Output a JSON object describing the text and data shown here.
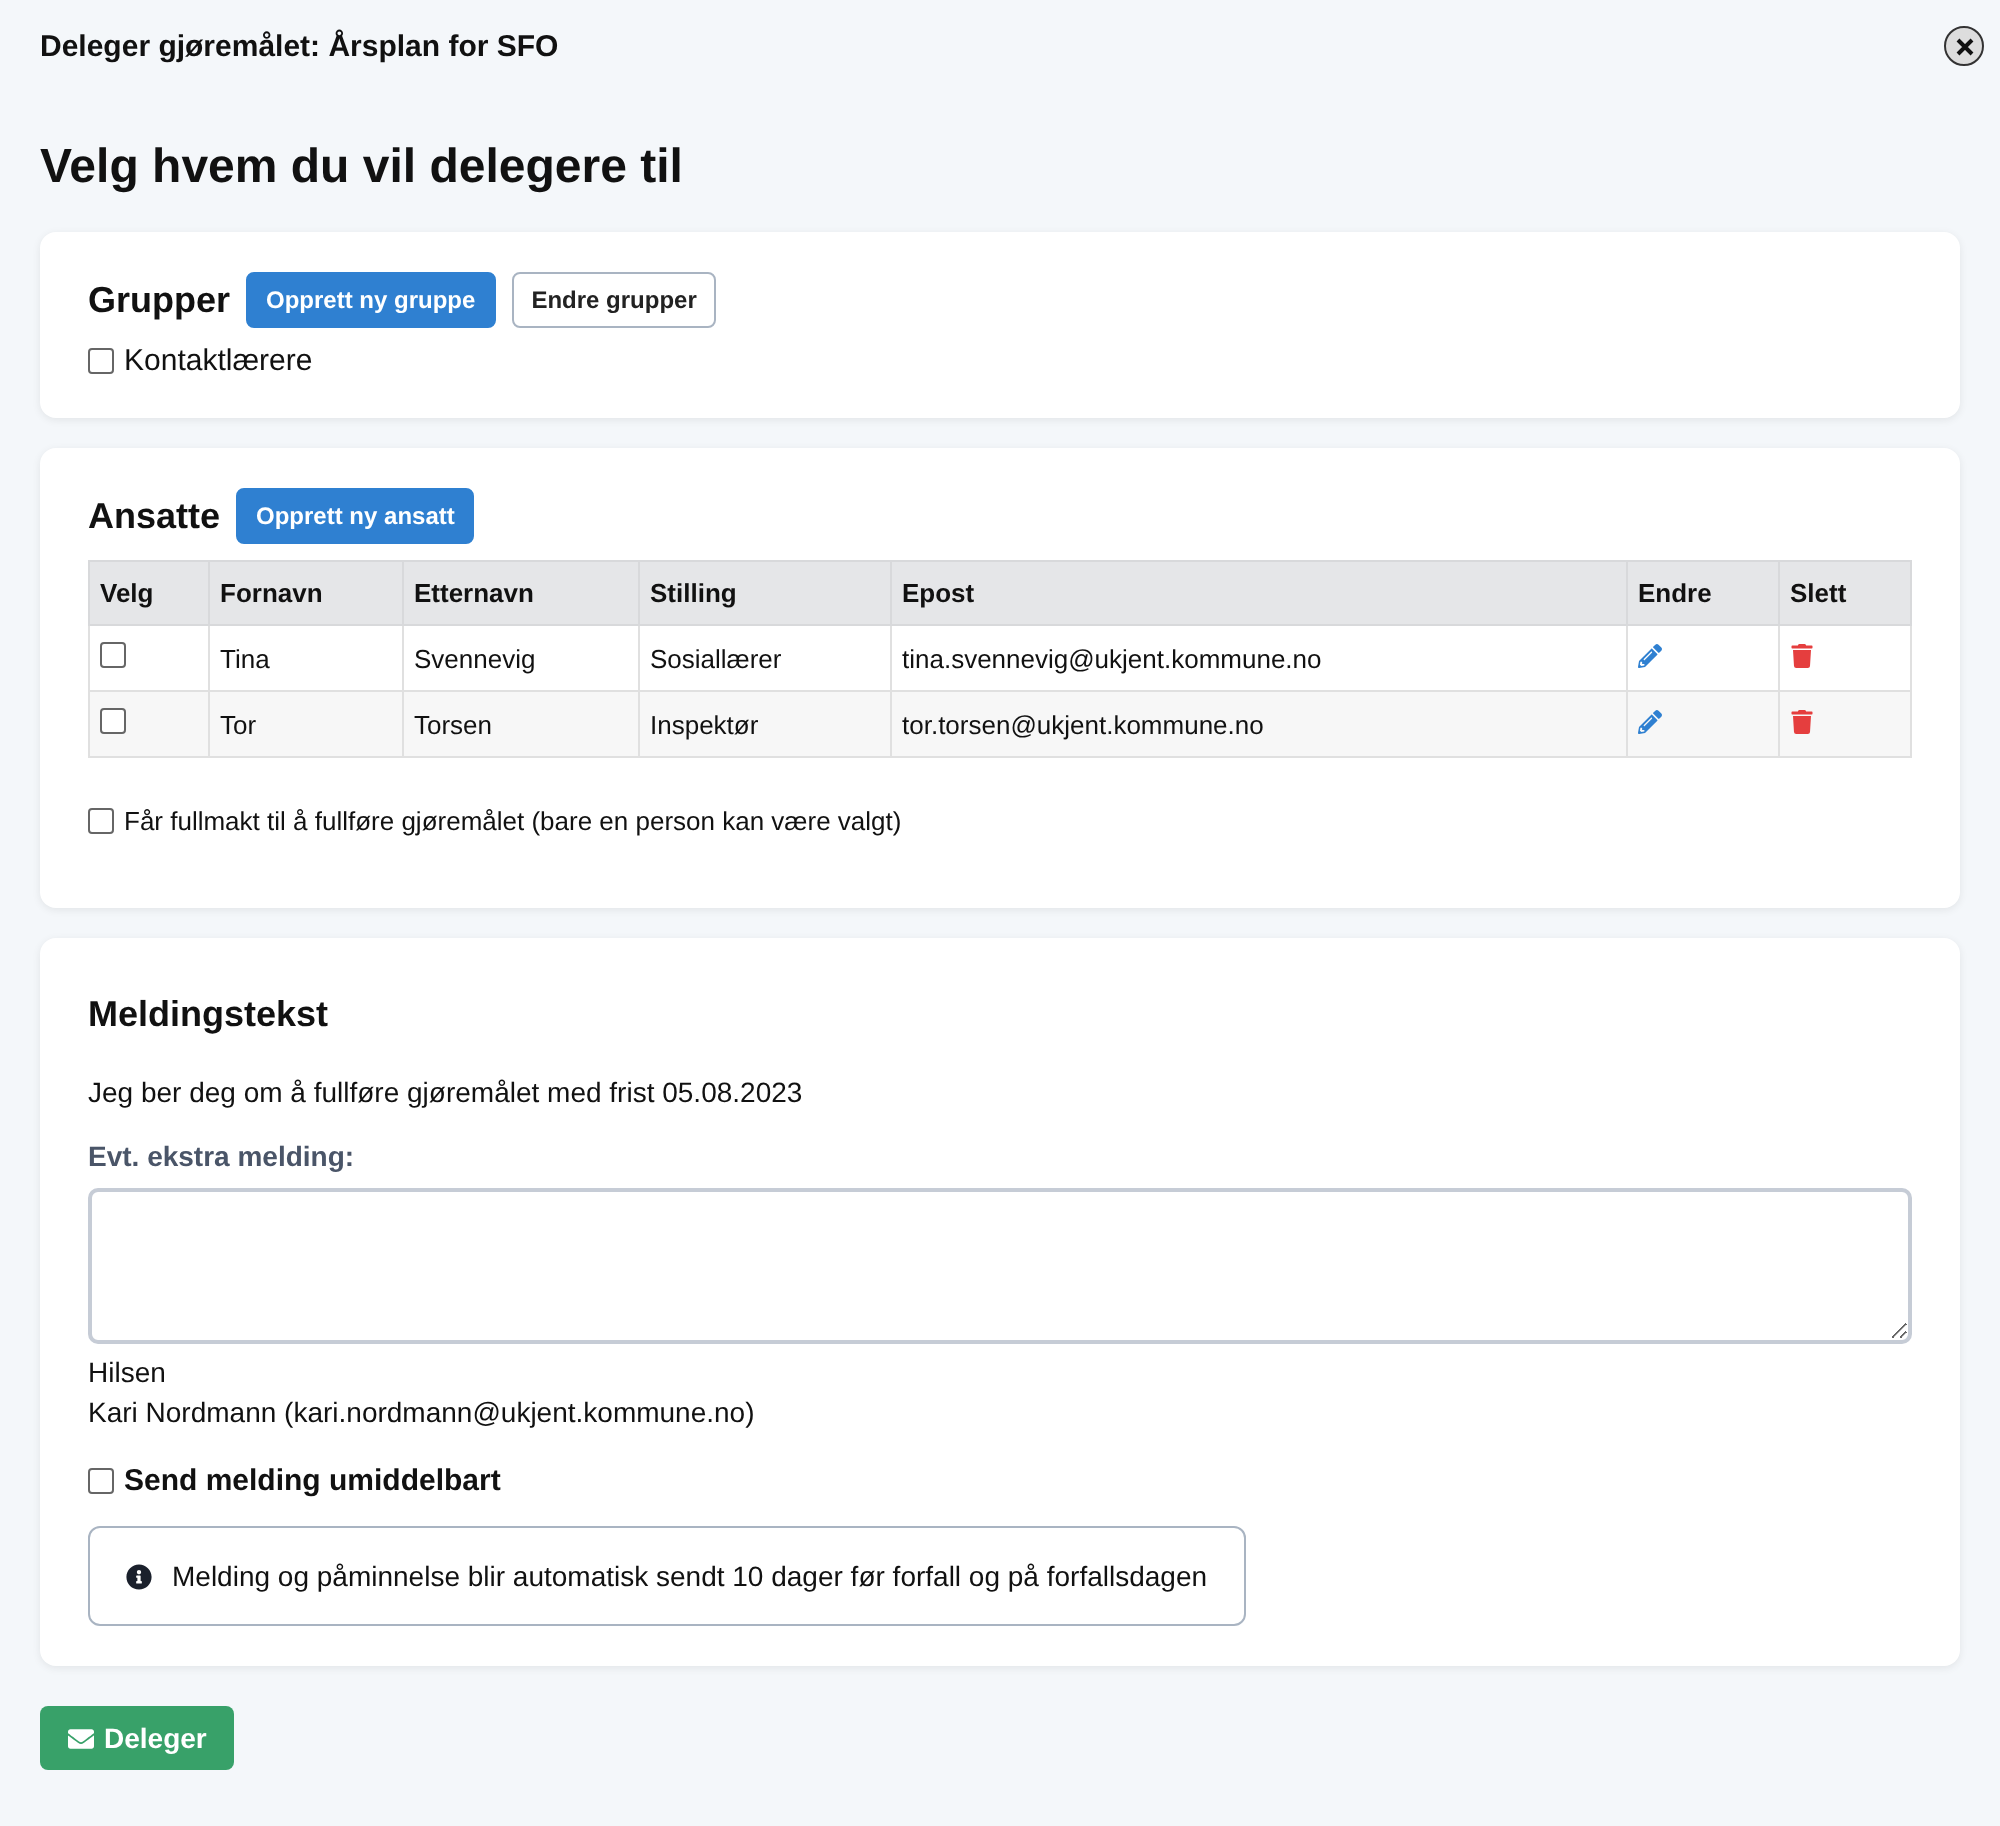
{
  "window": {
    "title": "Deleger gjøremålet: Årsplan for SFO"
  },
  "heading": "Velg hvem du vil delegere til",
  "groups": {
    "title": "Grupper",
    "buttons": [
      {
        "label": "Opprett ny gruppe",
        "kind": "primary"
      },
      {
        "label": "Endre grupper",
        "kind": "outline"
      }
    ],
    "items": [
      {
        "label": "Kontaktlærere",
        "checked": false
      }
    ]
  },
  "employees": {
    "title": "Ansatte",
    "button": "Opprett ny ansatt",
    "columns": [
      "Velg",
      "Fornavn",
      "Etternavn",
      "Stilling",
      "Epost",
      "Endre",
      "Slett"
    ],
    "rows": [
      {
        "checked": false,
        "first_name": "Tina",
        "last_name": "Svennevig",
        "position": "Sosiallærer",
        "email": "tina.svennevig@ukjent.kommune.no"
      },
      {
        "checked": false,
        "first_name": "Tor",
        "last_name": "Torsen",
        "position": "Inspektør",
        "email": "tor.torsen@ukjent.kommune.no"
      }
    ],
    "authority": {
      "label": "Får fullmakt til å fullføre gjøremålet (bare en person kan være valgt)",
      "checked": false
    }
  },
  "message": {
    "title": "Meldingstekst",
    "text": "Jeg ber deg om å fullføre gjøremålet med frist 05.08.2023",
    "extra_label": "Evt. ekstra melding:",
    "greeting": "Hilsen",
    "sender": "Kari Nordmann (kari.nordmann@ukjent.kommune.no)",
    "send_now": {
      "label": "Send melding umiddelbart",
      "checked": false
    },
    "info": "Melding og påminnelse blir automatisk sendt 10 dager før forfall og på forfallsdagen"
  },
  "submit": "Deleger"
}
